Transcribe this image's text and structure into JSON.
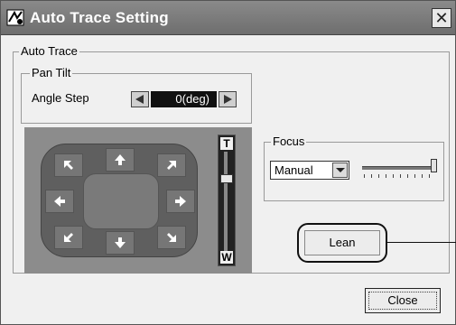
{
  "window": {
    "title": "Auto Trace Setting",
    "close_glyph": "✕"
  },
  "auto_trace": {
    "label": "Auto Trace",
    "pan_tilt": {
      "label": "Pan Tilt",
      "angle_step_label": "Angle Step",
      "angle_step_value": "0(deg)"
    },
    "zoom": {
      "top_label": "T",
      "bottom_label": "W",
      "level": 0.75
    },
    "focus": {
      "label": "Focus",
      "mode_value": "Manual",
      "slider_level": 1.0
    },
    "lean_label": "Lean"
  },
  "footer": {
    "close_label": "Close"
  },
  "colors": {
    "titlebar": "#7a7a7a",
    "panel": "#8c8c8c",
    "pad": "#5f5f5f"
  }
}
